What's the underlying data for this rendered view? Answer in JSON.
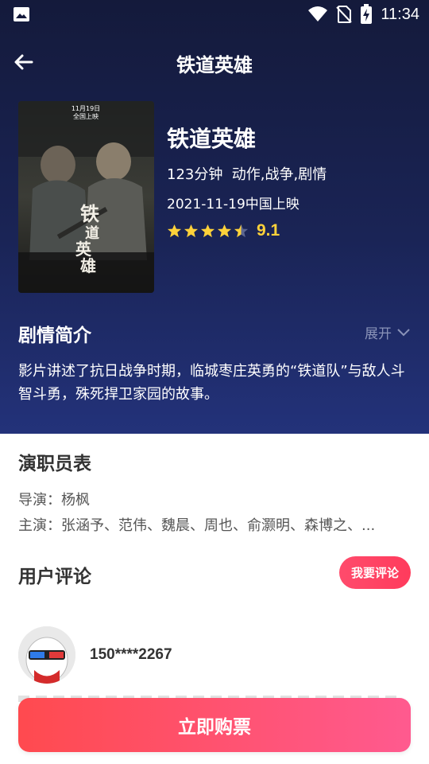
{
  "status_bar": {
    "time": "11:34",
    "icons": [
      "image-icon",
      "wifi-icon",
      "no-sim-icon",
      "battery-charging-icon"
    ]
  },
  "app_bar": {
    "title": "铁道英雄",
    "back_icon": "arrow-left-icon"
  },
  "movie": {
    "title": "铁道英雄",
    "meta": "123分钟  动作,战争,剧情",
    "release": "2021-11-19中国上映",
    "rating_stars": 4.5,
    "rating_score": "9.1",
    "poster_text": {
      "top": "11月19日\n全国上映",
      "title": "铁道英雄"
    }
  },
  "synopsis": {
    "heading": "剧情简介",
    "expand_label": "展开",
    "text": "影片讲述了抗日战争时期，临城枣庄英勇的“铁道队”与敌人斗智斗勇，殊死捍卫家园的故事。"
  },
  "cast": {
    "heading": "演职员表",
    "director": "导演：杨枫",
    "actors": "主演：张涵予、范伟、魏晨、周也、俞灏明、森博之、..."
  },
  "reviews": {
    "heading": "用户评论",
    "write_button": "我要评论",
    "items": [
      {
        "user": "150****2267"
      }
    ]
  },
  "buy_button": "立即购票",
  "colors": {
    "accent": "#ff4b6c",
    "star": "#ffd23a",
    "hero_top": "#141a3b",
    "hero_bottom": "#23327a"
  }
}
